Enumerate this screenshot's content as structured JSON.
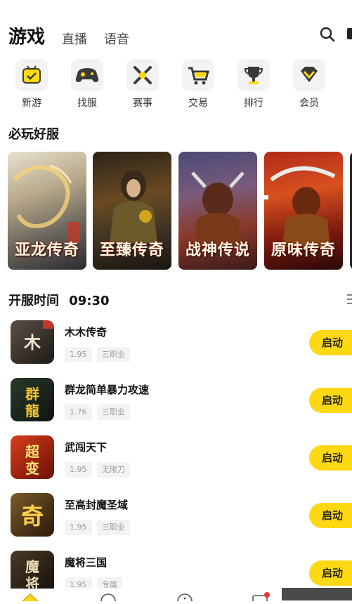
{
  "header": {
    "title": "游戏",
    "tabs": [
      "直播",
      "语音"
    ]
  },
  "categories": [
    {
      "label": "新游",
      "icon": "new-game-icon"
    },
    {
      "label": "找服",
      "icon": "gamepad-icon"
    },
    {
      "label": "赛事",
      "icon": "crossed-swords-icon"
    },
    {
      "label": "交易",
      "icon": "cart-icon"
    },
    {
      "label": "排行",
      "icon": "trophy-icon"
    },
    {
      "label": "会员",
      "icon": "vip-diamond-icon"
    }
  ],
  "featured": {
    "title": "必玩好服",
    "banners": [
      {
        "title": "亚龙传奇"
      },
      {
        "title": "至臻传奇"
      },
      {
        "title": "战神传说"
      },
      {
        "title": "原味传奇"
      }
    ]
  },
  "server_time": {
    "label": "开服时间",
    "time": "09:30"
  },
  "games": [
    {
      "name": "木木传奇",
      "version": "1.95",
      "tag": "三职业",
      "action": "启动"
    },
    {
      "name": "群龙简单暴力攻速",
      "version": "1.76",
      "tag": "三职业",
      "action": "启动"
    },
    {
      "name": "武闯天下",
      "version": "1.95",
      "tag": "无限刀",
      "action": "启动"
    },
    {
      "name": "至高封魔圣域",
      "version": "1.95",
      "tag": "三职业",
      "action": "启动"
    },
    {
      "name": "魔将三国",
      "version": "1.95",
      "tag": "专属",
      "action": "启动"
    }
  ],
  "colors": {
    "accent": "#ffd814",
    "icon_bg": "#f3f3f3",
    "tag_text": "#9a9a9a"
  }
}
